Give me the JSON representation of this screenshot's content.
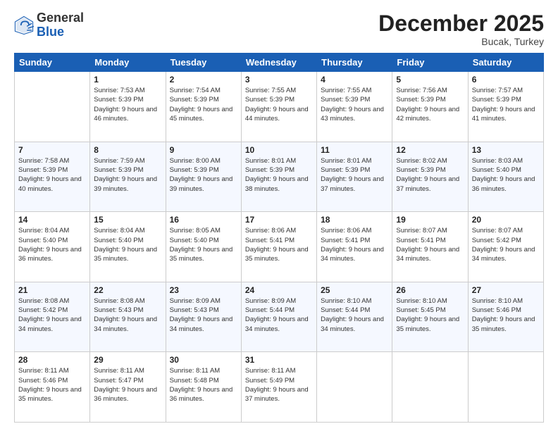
{
  "header": {
    "logo_general": "General",
    "logo_blue": "Blue",
    "month_title": "December 2025",
    "location": "Bucak, Turkey"
  },
  "days_of_week": [
    "Sunday",
    "Monday",
    "Tuesday",
    "Wednesday",
    "Thursday",
    "Friday",
    "Saturday"
  ],
  "weeks": [
    [
      {
        "day": "",
        "sunrise": "",
        "sunset": "",
        "daylight": ""
      },
      {
        "day": "1",
        "sunrise": "Sunrise: 7:53 AM",
        "sunset": "Sunset: 5:39 PM",
        "daylight": "Daylight: 9 hours and 46 minutes."
      },
      {
        "day": "2",
        "sunrise": "Sunrise: 7:54 AM",
        "sunset": "Sunset: 5:39 PM",
        "daylight": "Daylight: 9 hours and 45 minutes."
      },
      {
        "day": "3",
        "sunrise": "Sunrise: 7:55 AM",
        "sunset": "Sunset: 5:39 PM",
        "daylight": "Daylight: 9 hours and 44 minutes."
      },
      {
        "day": "4",
        "sunrise": "Sunrise: 7:55 AM",
        "sunset": "Sunset: 5:39 PM",
        "daylight": "Daylight: 9 hours and 43 minutes."
      },
      {
        "day": "5",
        "sunrise": "Sunrise: 7:56 AM",
        "sunset": "Sunset: 5:39 PM",
        "daylight": "Daylight: 9 hours and 42 minutes."
      },
      {
        "day": "6",
        "sunrise": "Sunrise: 7:57 AM",
        "sunset": "Sunset: 5:39 PM",
        "daylight": "Daylight: 9 hours and 41 minutes."
      }
    ],
    [
      {
        "day": "7",
        "sunrise": "Sunrise: 7:58 AM",
        "sunset": "Sunset: 5:39 PM",
        "daylight": "Daylight: 9 hours and 40 minutes."
      },
      {
        "day": "8",
        "sunrise": "Sunrise: 7:59 AM",
        "sunset": "Sunset: 5:39 PM",
        "daylight": "Daylight: 9 hours and 39 minutes."
      },
      {
        "day": "9",
        "sunrise": "Sunrise: 8:00 AM",
        "sunset": "Sunset: 5:39 PM",
        "daylight": "Daylight: 9 hours and 39 minutes."
      },
      {
        "day": "10",
        "sunrise": "Sunrise: 8:01 AM",
        "sunset": "Sunset: 5:39 PM",
        "daylight": "Daylight: 9 hours and 38 minutes."
      },
      {
        "day": "11",
        "sunrise": "Sunrise: 8:01 AM",
        "sunset": "Sunset: 5:39 PM",
        "daylight": "Daylight: 9 hours and 37 minutes."
      },
      {
        "day": "12",
        "sunrise": "Sunrise: 8:02 AM",
        "sunset": "Sunset: 5:39 PM",
        "daylight": "Daylight: 9 hours and 37 minutes."
      },
      {
        "day": "13",
        "sunrise": "Sunrise: 8:03 AM",
        "sunset": "Sunset: 5:40 PM",
        "daylight": "Daylight: 9 hours and 36 minutes."
      }
    ],
    [
      {
        "day": "14",
        "sunrise": "Sunrise: 8:04 AM",
        "sunset": "Sunset: 5:40 PM",
        "daylight": "Daylight: 9 hours and 36 minutes."
      },
      {
        "day": "15",
        "sunrise": "Sunrise: 8:04 AM",
        "sunset": "Sunset: 5:40 PM",
        "daylight": "Daylight: 9 hours and 35 minutes."
      },
      {
        "day": "16",
        "sunrise": "Sunrise: 8:05 AM",
        "sunset": "Sunset: 5:40 PM",
        "daylight": "Daylight: 9 hours and 35 minutes."
      },
      {
        "day": "17",
        "sunrise": "Sunrise: 8:06 AM",
        "sunset": "Sunset: 5:41 PM",
        "daylight": "Daylight: 9 hours and 35 minutes."
      },
      {
        "day": "18",
        "sunrise": "Sunrise: 8:06 AM",
        "sunset": "Sunset: 5:41 PM",
        "daylight": "Daylight: 9 hours and 34 minutes."
      },
      {
        "day": "19",
        "sunrise": "Sunrise: 8:07 AM",
        "sunset": "Sunset: 5:41 PM",
        "daylight": "Daylight: 9 hours and 34 minutes."
      },
      {
        "day": "20",
        "sunrise": "Sunrise: 8:07 AM",
        "sunset": "Sunset: 5:42 PM",
        "daylight": "Daylight: 9 hours and 34 minutes."
      }
    ],
    [
      {
        "day": "21",
        "sunrise": "Sunrise: 8:08 AM",
        "sunset": "Sunset: 5:42 PM",
        "daylight": "Daylight: 9 hours and 34 minutes."
      },
      {
        "day": "22",
        "sunrise": "Sunrise: 8:08 AM",
        "sunset": "Sunset: 5:43 PM",
        "daylight": "Daylight: 9 hours and 34 minutes."
      },
      {
        "day": "23",
        "sunrise": "Sunrise: 8:09 AM",
        "sunset": "Sunset: 5:43 PM",
        "daylight": "Daylight: 9 hours and 34 minutes."
      },
      {
        "day": "24",
        "sunrise": "Sunrise: 8:09 AM",
        "sunset": "Sunset: 5:44 PM",
        "daylight": "Daylight: 9 hours and 34 minutes."
      },
      {
        "day": "25",
        "sunrise": "Sunrise: 8:10 AM",
        "sunset": "Sunset: 5:44 PM",
        "daylight": "Daylight: 9 hours and 34 minutes."
      },
      {
        "day": "26",
        "sunrise": "Sunrise: 8:10 AM",
        "sunset": "Sunset: 5:45 PM",
        "daylight": "Daylight: 9 hours and 35 minutes."
      },
      {
        "day": "27",
        "sunrise": "Sunrise: 8:10 AM",
        "sunset": "Sunset: 5:46 PM",
        "daylight": "Daylight: 9 hours and 35 minutes."
      }
    ],
    [
      {
        "day": "28",
        "sunrise": "Sunrise: 8:11 AM",
        "sunset": "Sunset: 5:46 PM",
        "daylight": "Daylight: 9 hours and 35 minutes."
      },
      {
        "day": "29",
        "sunrise": "Sunrise: 8:11 AM",
        "sunset": "Sunset: 5:47 PM",
        "daylight": "Daylight: 9 hours and 36 minutes."
      },
      {
        "day": "30",
        "sunrise": "Sunrise: 8:11 AM",
        "sunset": "Sunset: 5:48 PM",
        "daylight": "Daylight: 9 hours and 36 minutes."
      },
      {
        "day": "31",
        "sunrise": "Sunrise: 8:11 AM",
        "sunset": "Sunset: 5:49 PM",
        "daylight": "Daylight: 9 hours and 37 minutes."
      },
      {
        "day": "",
        "sunrise": "",
        "sunset": "",
        "daylight": ""
      },
      {
        "day": "",
        "sunrise": "",
        "sunset": "",
        "daylight": ""
      },
      {
        "day": "",
        "sunrise": "",
        "sunset": "",
        "daylight": ""
      }
    ]
  ]
}
